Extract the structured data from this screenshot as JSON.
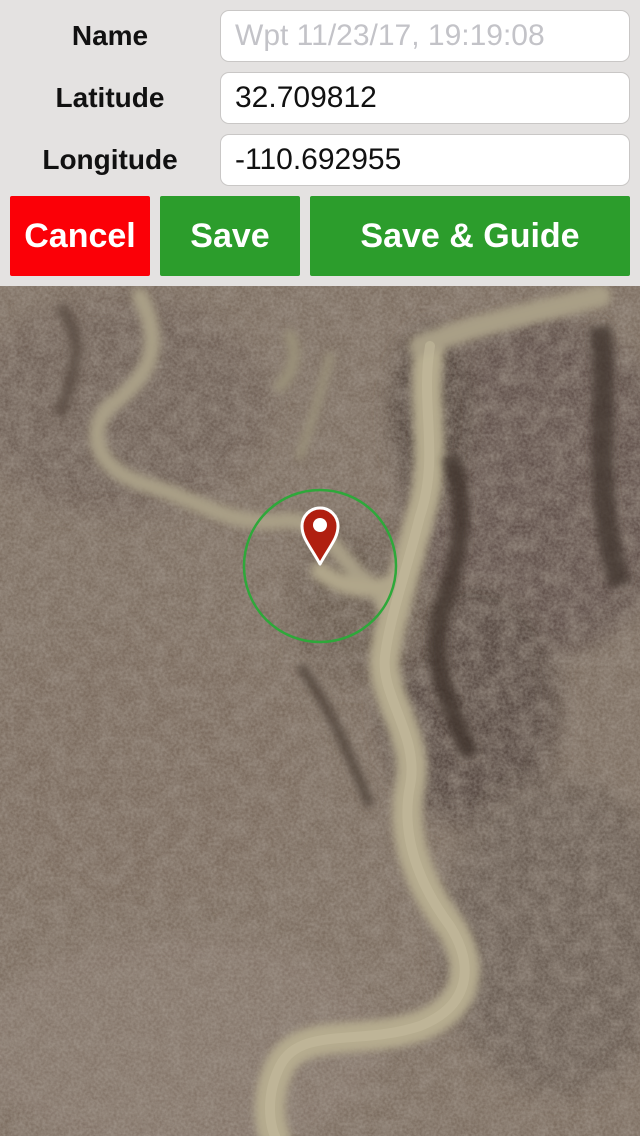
{
  "form": {
    "name_label": "Name",
    "name_value": "",
    "name_placeholder": "Wpt 11/23/17, 19:19:08",
    "latitude_label": "Latitude",
    "latitude_value": "32.709812",
    "longitude_label": "Longitude",
    "longitude_value": "-110.692955"
  },
  "buttons": {
    "cancel_label": "Cancel",
    "save_label": "Save",
    "save_guide_label": "Save & Guide"
  },
  "colors": {
    "cancel": "#fb0007",
    "save": "#2c9d2c",
    "accuracy_circle": "#2ea83a",
    "pin": "#b01f10"
  },
  "map": {
    "type": "satellite",
    "pin_icon": "map-pin-icon",
    "accuracy_icon": "accuracy-circle-icon"
  }
}
